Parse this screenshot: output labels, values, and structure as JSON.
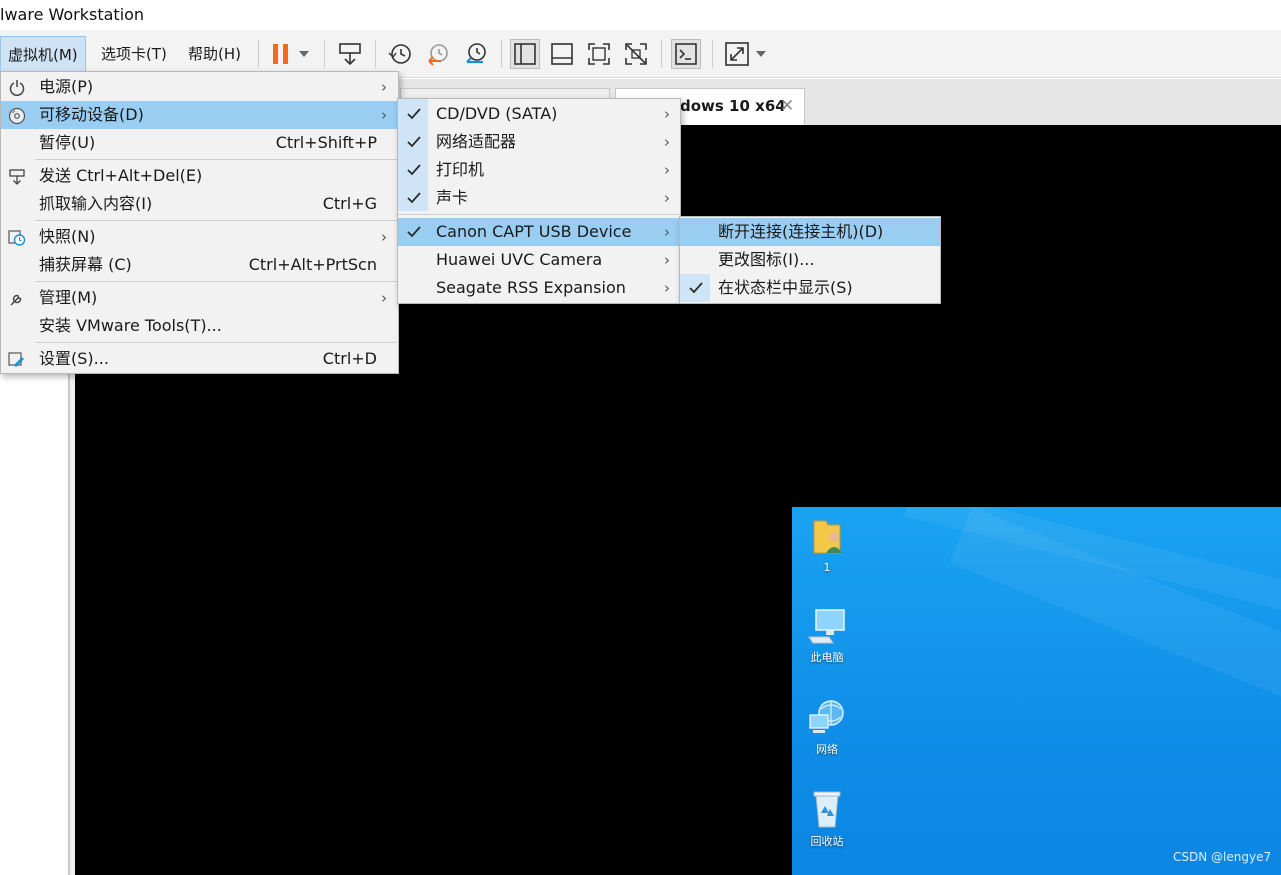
{
  "window": {
    "title": "lware Workstation"
  },
  "toolbar": {
    "menus": [
      {
        "label": "虚拟机(M)"
      },
      {
        "label": "选项卡(T)"
      },
      {
        "label": "帮助(H)"
      }
    ],
    "accent_color": "#f26b1d"
  },
  "tabs": {
    "active_title": "dows 10 x64",
    "close_glyph": "✕"
  },
  "vm_menu": {
    "items": [
      {
        "label": "电源(P)",
        "icon": "power-icon",
        "submenu": true
      },
      {
        "label": "可移动设备(D)",
        "icon": "removable-device-icon",
        "submenu": true,
        "highlighted": true
      },
      {
        "label": "暂停(U)",
        "shortcut": "Ctrl+Shift+P"
      },
      {
        "label": "发送 Ctrl+Alt+Del(E)",
        "icon": "send-keys-icon"
      },
      {
        "label": "抓取输入内容(I)",
        "shortcut": "Ctrl+G"
      },
      {
        "label": "快照(N)",
        "icon": "snapshot-icon",
        "submenu": true
      },
      {
        "label": "捕获屏幕 (C)",
        "shortcut": "Ctrl+Alt+PrtScn"
      },
      {
        "label": "管理(M)",
        "icon": "wrench-icon",
        "submenu": true
      },
      {
        "label": "安装 VMware Tools(T)..."
      },
      {
        "label": "设置(S)...",
        "icon": "settings-icon",
        "shortcut": "Ctrl+D"
      }
    ]
  },
  "device_menu": {
    "items": [
      {
        "label": "CD/DVD (SATA)",
        "checked": true,
        "submenu": true
      },
      {
        "label": "网络适配器",
        "checked": true,
        "submenu": true
      },
      {
        "label": "打印机",
        "checked": true,
        "submenu": true
      },
      {
        "label": "声卡",
        "checked": true,
        "submenu": true
      },
      {
        "label": "Canon CAPT USB Device",
        "checked": true,
        "submenu": true,
        "highlighted": true
      },
      {
        "label": "Huawei UVC Camera",
        "checked": false,
        "submenu": true
      },
      {
        "label": "Seagate RSS Expansion",
        "checked": false,
        "submenu": true
      }
    ]
  },
  "usb_menu": {
    "items": [
      {
        "label": "断开连接(连接主机)(D)",
        "highlighted": true
      },
      {
        "label": "更改图标(I)..."
      },
      {
        "label": "在状态栏中显示(S)",
        "checked": true
      }
    ]
  },
  "desktop": {
    "icons": [
      {
        "label": "1",
        "icon": "user-folder-icon"
      },
      {
        "label": "此电脑",
        "icon": "this-pc-icon"
      },
      {
        "label": "网络",
        "icon": "network-icon"
      },
      {
        "label": "回收站",
        "icon": "recycle-bin-icon"
      }
    ]
  },
  "watermark": "CSDN @lengye7",
  "submenu_arrow": "›"
}
